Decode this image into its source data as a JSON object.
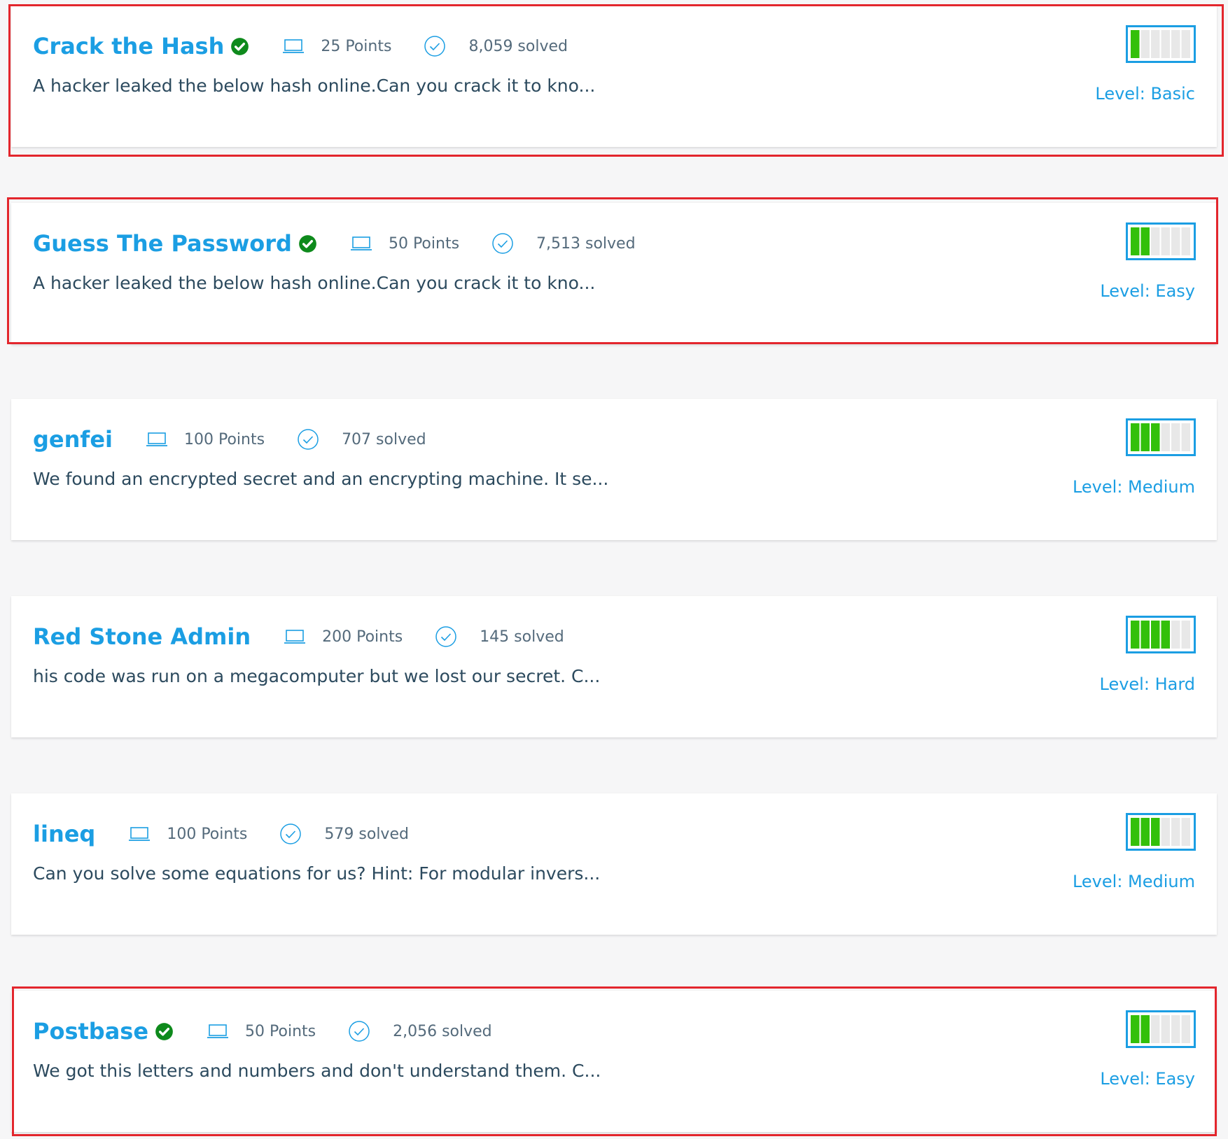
{
  "colors": {
    "accent": "#1b9ee3",
    "verified": "#0e8a1c",
    "level_fill": "#33c00a",
    "level_empty": "#e8e8e8",
    "highlight": "#e3262d"
  },
  "challenges": [
    {
      "title": "Crack the Hash",
      "verified": true,
      "points": "25 Points",
      "solved": "8,059 solved",
      "description": "A hacker leaked the below hash online.Can you crack it to kno...",
      "level": "Level: Basic",
      "level_bars": 1,
      "highlighted": true
    },
    {
      "title": "Guess The Password",
      "verified": true,
      "points": "50 Points",
      "solved": "7,513 solved",
      "description": "A hacker leaked the below hash online.Can you crack it to kno...",
      "level": "Level: Easy",
      "level_bars": 2,
      "highlighted": true
    },
    {
      "title": "genfei",
      "verified": false,
      "points": "100 Points",
      "solved": "707 solved",
      "description": "We found an encrypted secret and an encrypting machine. It se...",
      "level": "Level: Medium",
      "level_bars": 3,
      "highlighted": false
    },
    {
      "title": "Red Stone Admin",
      "verified": false,
      "points": "200 Points",
      "solved": "145 solved",
      "description": "his code was run on a megacomputer but we lost our secret. C...",
      "level": "Level: Hard",
      "level_bars": 4,
      "highlighted": false
    },
    {
      "title": "lineq",
      "verified": false,
      "points": "100 Points",
      "solved": "579 solved",
      "description": "Can you solve some equations for us? Hint: For modular invers...",
      "level": "Level: Medium",
      "level_bars": 3,
      "highlighted": false
    },
    {
      "title": "Postbase",
      "verified": true,
      "points": "50 Points",
      "solved": "2,056 solved",
      "description": "We got this letters and numbers and don't understand them. C...",
      "level": "Level: Easy",
      "level_bars": 2,
      "highlighted": true
    }
  ]
}
